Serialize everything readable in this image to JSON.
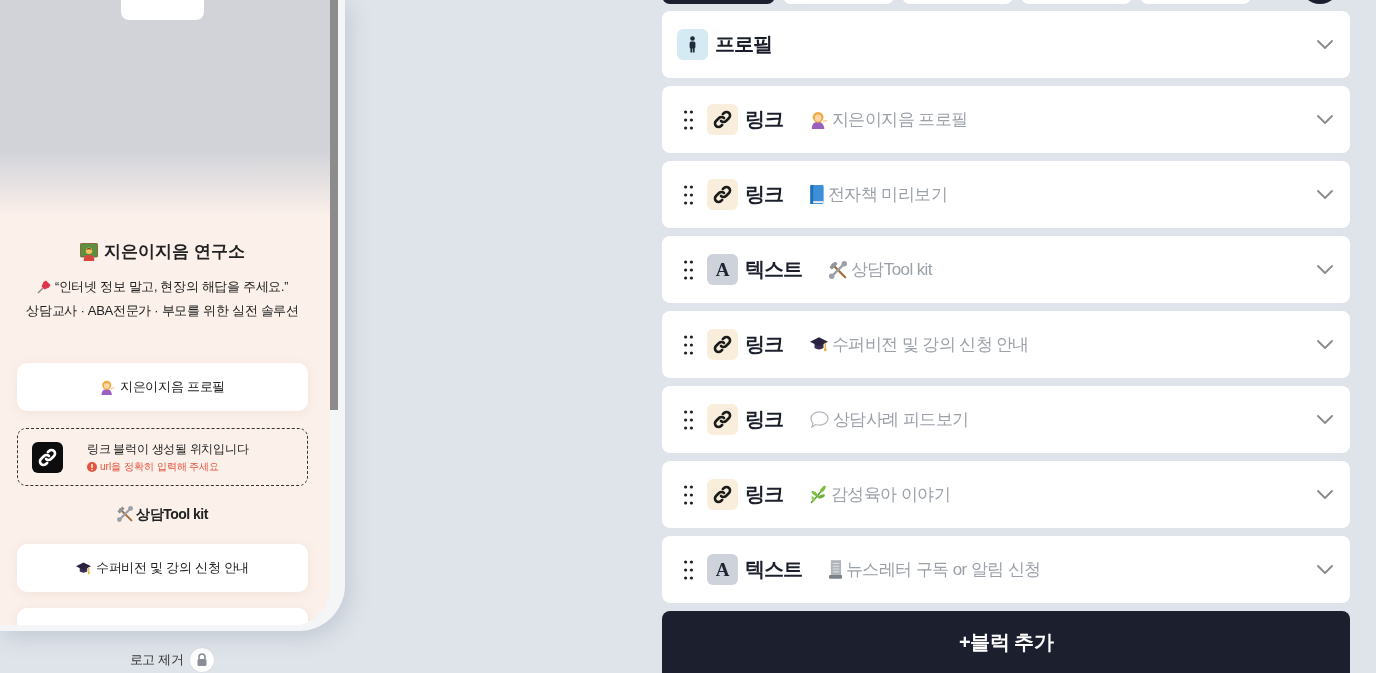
{
  "preview": {
    "title": "지은이지음 연구소",
    "quote": "“인터넷 정보 말고, 현장의 해답을 주세요.”",
    "subtitle": "상담교사 · ABA전문가 · 부모를 위한 실전 솔루션",
    "blocks": [
      {
        "kind": "button",
        "label": "지은이지음 프로필"
      },
      {
        "kind": "placeholder",
        "label": "링크 블럭이 생성될 위치입니다",
        "error": "url을 정확히 입력해 주세요"
      },
      {
        "kind": "heading",
        "label": "상담Tool kit"
      },
      {
        "kind": "button",
        "label": "수퍼비전 및 강의 신청 안내"
      },
      {
        "kind": "button"
      }
    ]
  },
  "remove_logo": {
    "label": "로고 제거"
  },
  "toolbar_tabs": [
    {
      "selected": true
    },
    {
      "selected": false
    },
    {
      "selected": false
    },
    {
      "selected": false
    },
    {
      "selected": false
    }
  ],
  "profile_block": {
    "label": "프로필"
  },
  "blocks": [
    {
      "kind": "link",
      "label": "링크",
      "title": "지은이지음 프로필"
    },
    {
      "kind": "link",
      "label": "링크",
      "title": "전자책 미리보기"
    },
    {
      "kind": "text",
      "badge": "A",
      "label": "텍스트",
      "title": "상담Tool kit"
    },
    {
      "kind": "link",
      "label": "링크",
      "title": "수퍼비전 및 강의 신청 안내"
    },
    {
      "kind": "link",
      "label": "링크",
      "title": "상담사례 피드보기"
    },
    {
      "kind": "link",
      "label": "링크",
      "title": "감성육아 이야기"
    },
    {
      "kind": "text",
      "badge": "A",
      "label": "텍스트",
      "title": "뉴스레터 구독 or 알림 신청"
    }
  ],
  "add_block_button": {
    "label": "+블럭 추가"
  }
}
